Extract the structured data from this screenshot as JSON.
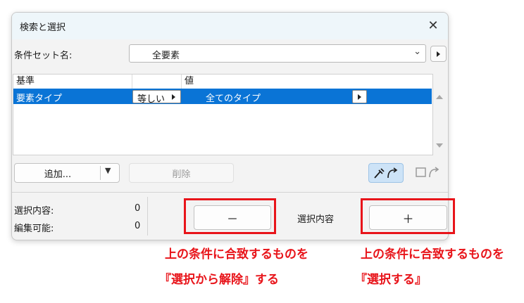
{
  "window": {
    "title": "検索と選択"
  },
  "criteria_set": {
    "label": "条件セット名:",
    "value": "全要素"
  },
  "table": {
    "headers": [
      "基準",
      "",
      "値"
    ],
    "rows": [
      {
        "criterion": "要素タイプ",
        "operator": "等しい",
        "value": "全てのタイプ"
      }
    ]
  },
  "buttons": {
    "add": "追加...",
    "delete": "削除",
    "deselect": "－",
    "select": "＋"
  },
  "status": {
    "selected_label": "選択内容:",
    "selected_count": "0",
    "editable_label": "編集可能:",
    "editable_count": "0"
  },
  "selection_label": "選択内容",
  "annotations": {
    "left_line1": "上の条件に合致するものを",
    "left_line2": "『選択から解除』する",
    "right_line1": "上の条件に合致するものを",
    "right_line2": "『選択する』"
  },
  "colors": {
    "selection": "#0a74d6",
    "annotation": "#e8141a",
    "titlebar": "#eef6fa"
  }
}
